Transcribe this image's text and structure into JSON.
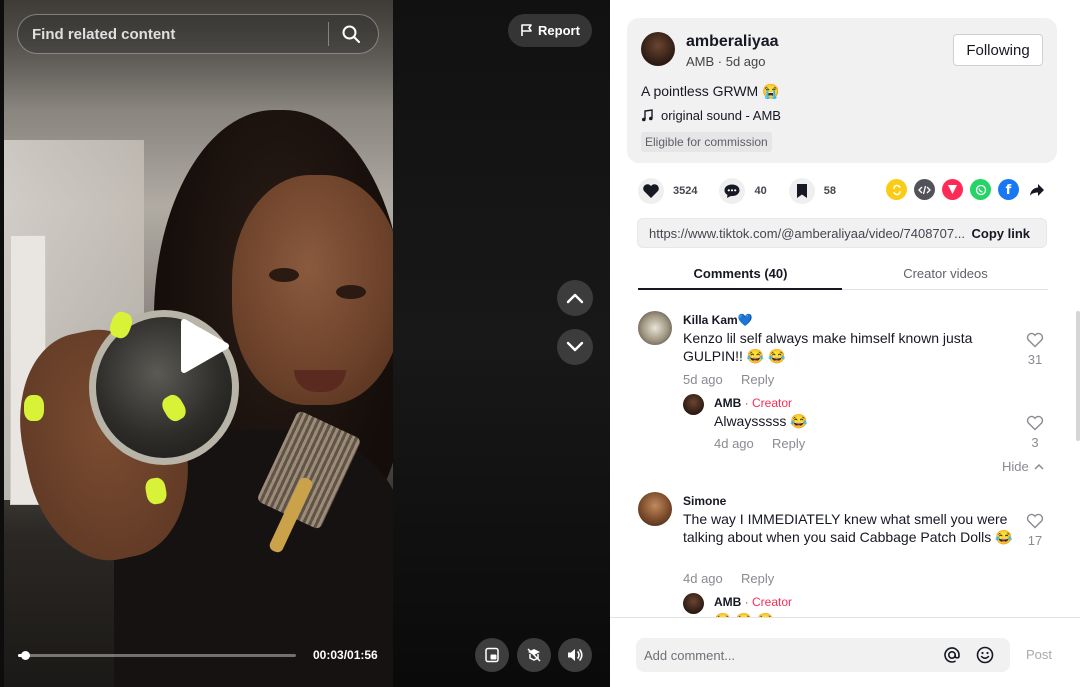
{
  "video": {
    "search_placeholder": "Find related content",
    "report_label": "Report",
    "time_display": "00:03/01:56",
    "progress": 0.026
  },
  "post": {
    "username": "amberaliyaa",
    "subline": "AMB · 5d ago",
    "follow_label": "Following",
    "description": "A pointless GRWM 😭",
    "sound": "original sound - AMB",
    "badge": "Eligible for commission"
  },
  "actions": {
    "likes": "3524",
    "comments": "40",
    "saves": "58"
  },
  "share": {
    "link": "https://www.tiktok.com/@amberaliyaa/video/7408707...",
    "copy_label": "Copy link"
  },
  "tabs": {
    "comments": "Comments (40)",
    "creator_videos": "Creator videos"
  },
  "comments": [
    {
      "name": "Killa Kam💙",
      "text": "Kenzo lil self always make himself known justa GULPIN!! 😂 😂",
      "time": "5d ago",
      "reply_label": "Reply",
      "likes": "31",
      "reply": {
        "name": "AMB",
        "role": " · Creator",
        "text": "Alwaysssss 😂",
        "time": "4d ago",
        "reply_label": "Reply",
        "likes": "3"
      },
      "hide_label": "Hide"
    },
    {
      "name": "Simone",
      "text": "The way I IMMEDIATELY knew what smell you were talking about when you said Cabbage Patch Dolls 😂",
      "time": "4d ago",
      "reply_label": "Reply",
      "likes": "17",
      "reply": {
        "name": "AMB",
        "role": " · Creator",
        "text": "😂 😂 😂"
      }
    }
  ],
  "composer": {
    "placeholder": "Add comment...",
    "post_label": "Post"
  },
  "colors": {
    "accent": "#fe2c55",
    "panel_bg": "#f1f1f2",
    "text": "#161823"
  }
}
